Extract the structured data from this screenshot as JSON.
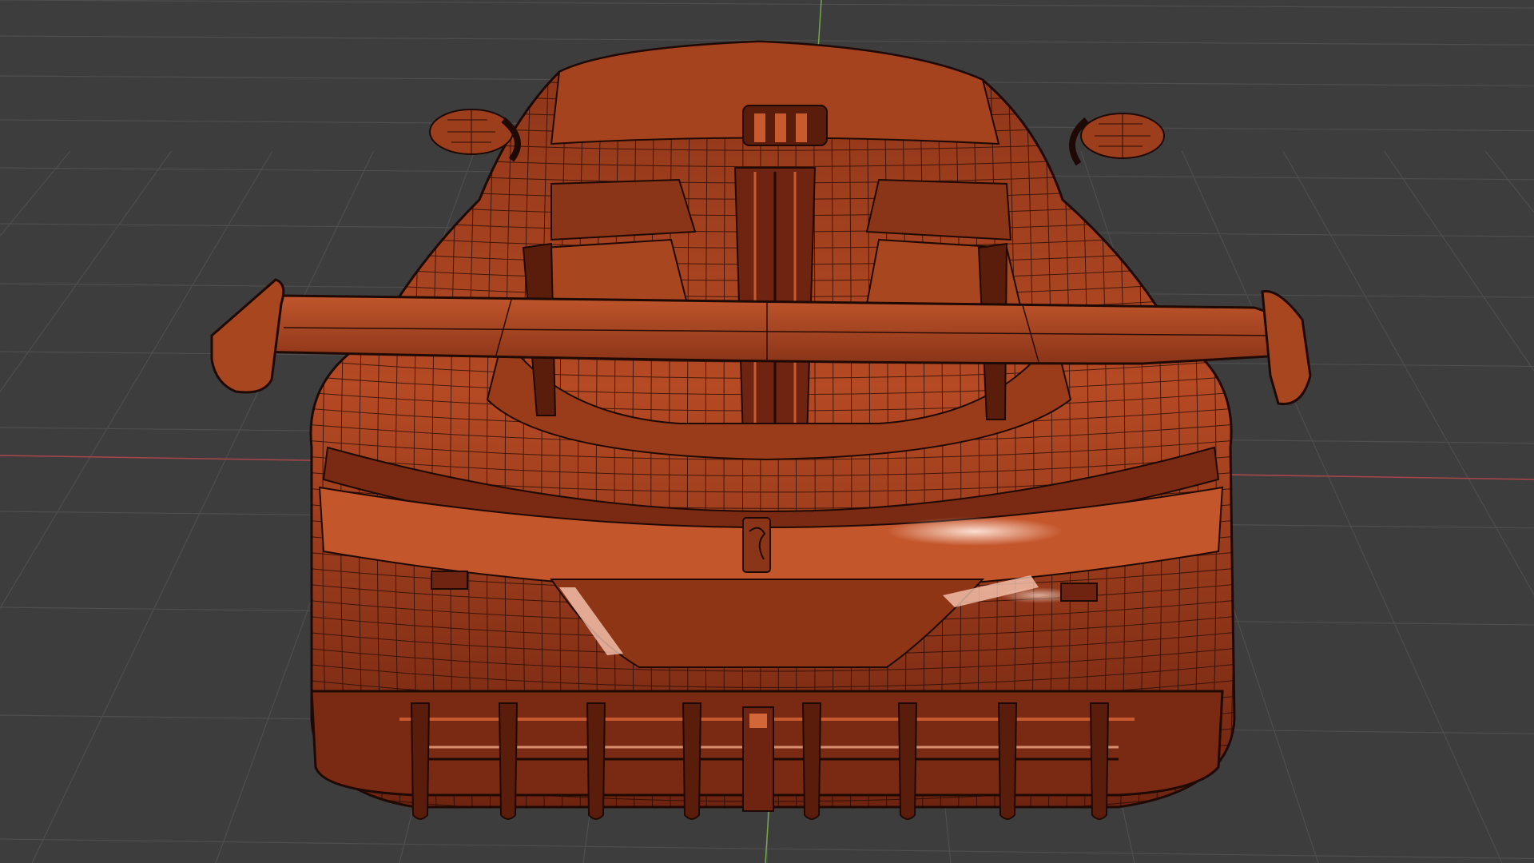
{
  "viewport": {
    "background": "#3d3d3d",
    "grid_color": "#4e4e4e",
    "x_axis_color": "#a8464a",
    "y_axis_color": "#76a84a",
    "grid_visible": true
  },
  "model": {
    "shading": "solid",
    "overlay": "wireframe",
    "view": "rear",
    "base_color": "#b54a24",
    "dark_color": "#5a1c0b",
    "highlight_color": "#ffd9c8",
    "wire_color": "#1f0904"
  }
}
